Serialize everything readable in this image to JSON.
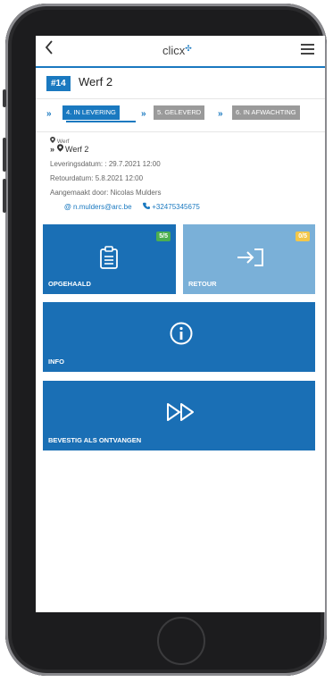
{
  "topbar": {
    "back_icon": "chevron-left-icon",
    "logo": "clicx",
    "logo_mark": "✣",
    "menu_icon": "hamburger-icon"
  },
  "header": {
    "id_badge": "#14",
    "title": "Werf 2"
  },
  "steps": [
    {
      "label": "4. IN LEVERING",
      "state": "active"
    },
    {
      "label": "5. GELEVERD",
      "state": "pending"
    },
    {
      "label": "6. IN AFWACHTING",
      "state": "pending"
    }
  ],
  "step_chevron": "»",
  "details": {
    "small_label": "Werf",
    "location": "Werf 2",
    "levering": "Leveringsdatum: : 29.7.2021 12:00",
    "retour": "Retourdatum: 5.8.2021 12:00",
    "aangemaakt": "Aangemaakt door: Nicolas Mulders",
    "email": "n.mulders@arc.be",
    "phone": "+32475345675"
  },
  "tiles": {
    "opgehaald": {
      "label": "OPGEHAALD",
      "count": "5/5",
      "icon": "clipboard-list-icon",
      "color": "#1a6fb5",
      "badge_color": "#4caf50"
    },
    "retour": {
      "label": "RETOUR",
      "count": "0/5",
      "icon": "sign-in-arrow-icon",
      "color": "#7ab0d8",
      "badge_color": "#f3c74a"
    },
    "info": {
      "label": "INFO",
      "icon": "info-circle-icon",
      "color": "#1a6fb5"
    },
    "bevestig": {
      "label": "BEVESTIG ALS ONTVANGEN",
      "icon": "fast-forward-icon",
      "color": "#1a6fb5"
    }
  }
}
